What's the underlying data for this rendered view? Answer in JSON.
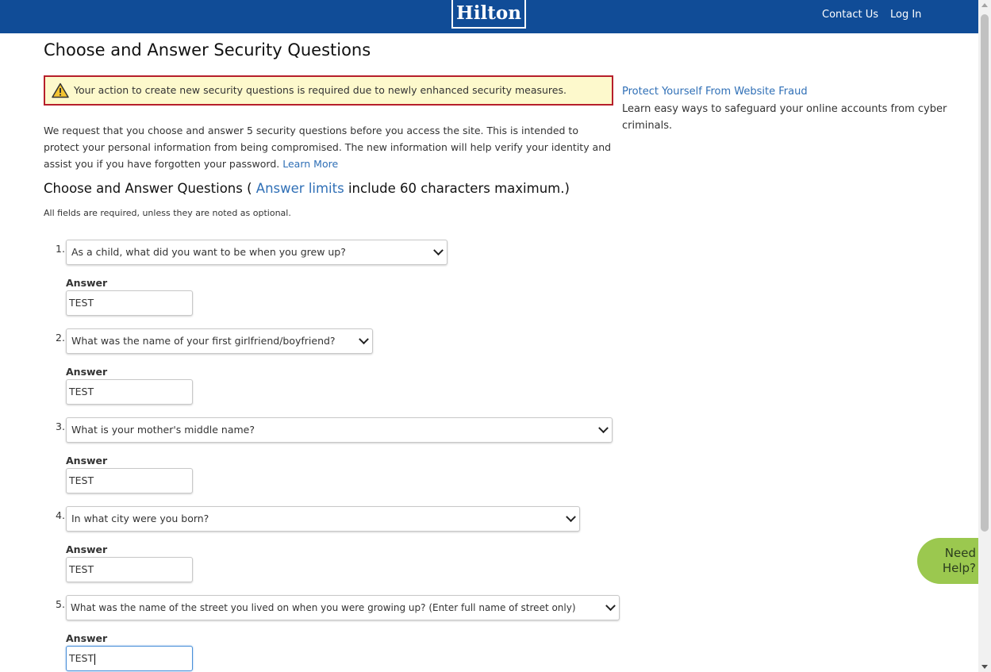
{
  "header": {
    "logo_text": "Hilton",
    "contact_label": "Contact Us",
    "login_label": "Log In",
    "brand_color": "#104c97"
  },
  "page": {
    "title": "Choose and Answer Security Questions",
    "alert": {
      "icon": "warning-triangle-icon",
      "text": "Your action to create new security questions is required due to newly enhanced security measures."
    },
    "intro_text": "We request that you choose and answer 5 security questions before you access the site. This is intended to protect your personal information from being compromised. The new information will help verify your identity and assist you if you have forgotten your password.",
    "learn_more_label": "Learn More",
    "subtitle_prefix": "Choose and Answer Questions (",
    "subtitle_link": "Answer limits",
    "subtitle_suffix": "include 60 characters maximum.)",
    "required_note": "All fields are required, unless they are noted as optional."
  },
  "questions": [
    {
      "number": "1.",
      "question": "As a child, what did you want to be when you grew up?",
      "answer_label": "Answer",
      "answer": "TEST"
    },
    {
      "number": "2.",
      "question": "What was the name of your first girlfriend/boyfriend?",
      "answer_label": "Answer",
      "answer": "TEST"
    },
    {
      "number": "3.",
      "question": "What is your mother's middle name?",
      "answer_label": "Answer",
      "answer": "TEST"
    },
    {
      "number": "4.",
      "question": "In what city were you born?",
      "answer_label": "Answer",
      "answer": "TEST"
    },
    {
      "number": "5.",
      "question": "What was the name of the street you lived on when you were growing up? (Enter full name of street only)",
      "answer_label": "Answer",
      "answer": "TEST"
    }
  ],
  "sidebar": {
    "fraud_link": "Protect Yourself From Website Fraud",
    "fraud_desc": "Learn easy ways to safeguard your online accounts from cyber criminals."
  },
  "help_widget": {
    "line1": "Need",
    "line2": "Help?",
    "color": "#9bc84f"
  }
}
